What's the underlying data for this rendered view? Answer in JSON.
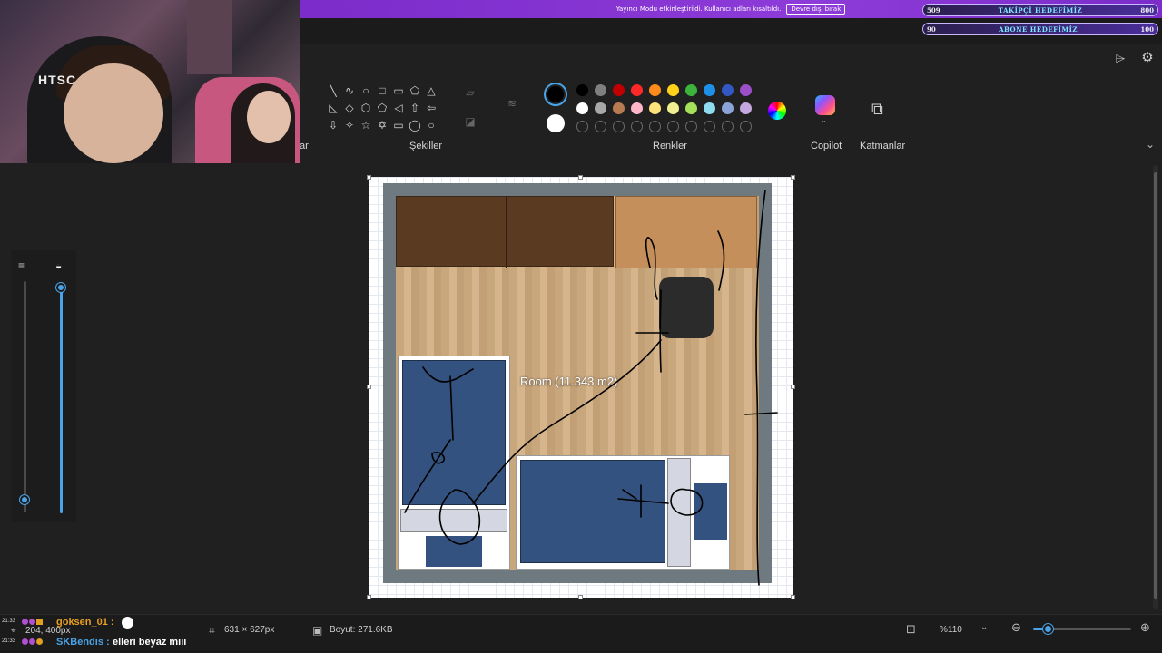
{
  "stream": {
    "banner_text": "Yayıncı Modu etkinleştirildi. Kullanıcı adları kısaltıldı.",
    "banner_button": "Devre dışı bırak",
    "webcam_logo": "HTSC",
    "goals": [
      {
        "left": "509",
        "title": "TAKİPÇİ HEDEFİMİZ",
        "right": "800"
      },
      {
        "left": "90",
        "title": "ABONE HEDEFİMİZ",
        "right": "100"
      }
    ]
  },
  "ribbon": {
    "shapes_label": "Şekiller",
    "colors_label": "Renkler",
    "copilot_label": "Copilot",
    "layers_label": "Katmanlar",
    "cropped_label": "ar",
    "shapes": [
      "╲",
      "∿",
      "○",
      "□",
      "▭",
      "⬠",
      "△",
      "◺",
      "◇",
      "⬡",
      "⬠",
      "◁",
      "⇧",
      "⇦",
      "⇩",
      "✧",
      "☆",
      "✡",
      "▭",
      "◯",
      "○"
    ],
    "colors_row1": [
      "#000000",
      "#7f7f7f",
      "#c00000",
      "#ff2828",
      "#ff8c1a",
      "#ffd21a",
      "#3cb43c",
      "#1e90e8",
      "#3358c4",
      "#9b4fc9"
    ],
    "colors_row2": [
      "#ffffff",
      "#a8a8a8",
      "#b87a50",
      "#ffb6c8",
      "#ffe27a",
      "#f0ee90",
      "#a4e05a",
      "#8edcf0",
      "#8aa4d8",
      "#c6a8e0"
    ],
    "colors_row3_empty": 10
  },
  "canvas": {
    "room_label": "Room (11.343 m2)"
  },
  "status": {
    "dimensions": "631 × 627px",
    "size": "Boyut: 271.6KB",
    "zoom": "%110",
    "coords": "204, 400px"
  },
  "chat": [
    {
      "time": "21:33",
      "user": "goksen_01 :",
      "msg": ""
    },
    {
      "time": "21:33",
      "user": "SKBendis :",
      "msg": "elleri beyaz mııı"
    }
  ],
  "colors": {
    "accent": "#4aa3e8",
    "banner": "#8d3bd9"
  }
}
